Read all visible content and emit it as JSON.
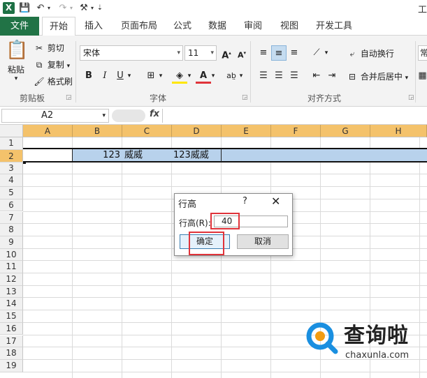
{
  "window": {
    "title_fragment": "工"
  },
  "tabs": [
    "文件",
    "开始",
    "插入",
    "页面布局",
    "公式",
    "数据",
    "审阅",
    "视图",
    "开发工具"
  ],
  "ribbon": {
    "clipboard": {
      "paste": "粘贴",
      "cut": "剪切",
      "copy": "复制",
      "format_painter": "格式刷",
      "group_label": "剪贴板"
    },
    "font": {
      "font_name": "宋体",
      "font_size": "11",
      "bold": "B",
      "italic": "I",
      "underline": "U",
      "group_label": "字体"
    },
    "alignment": {
      "wrap_text": "自动换行",
      "merge_center": "合并后居中",
      "group_label": "对齐方式"
    },
    "number": {
      "format_fragment": "常"
    }
  },
  "formula_bar": {
    "name_box": "A2",
    "fx": "fx"
  },
  "columns": [
    "A",
    "B",
    "C",
    "D",
    "E",
    "F",
    "G",
    "H"
  ],
  "rows": [
    "1",
    "2",
    "3",
    "4",
    "5",
    "6",
    "7",
    "8",
    "9",
    "10",
    "11",
    "12",
    "13",
    "14",
    "15",
    "16",
    "17",
    "18",
    "19"
  ],
  "cells": {
    "B2": "123",
    "C2": "威威",
    "D2": "123威威"
  },
  "dialog": {
    "title": "行高",
    "help": "?",
    "close": "✕",
    "label": "行高(R):",
    "value": "40",
    "ok": "确定",
    "cancel": "取消"
  },
  "watermark": {
    "brand": "查询啦",
    "url": "chaxunla.com"
  },
  "colors": {
    "file_tab": "#217346",
    "header_selected": "#f4c26b",
    "row_selection": "#b8d2ec",
    "highlight": "#e0333a",
    "watermark_blue": "#1a8fe0"
  }
}
